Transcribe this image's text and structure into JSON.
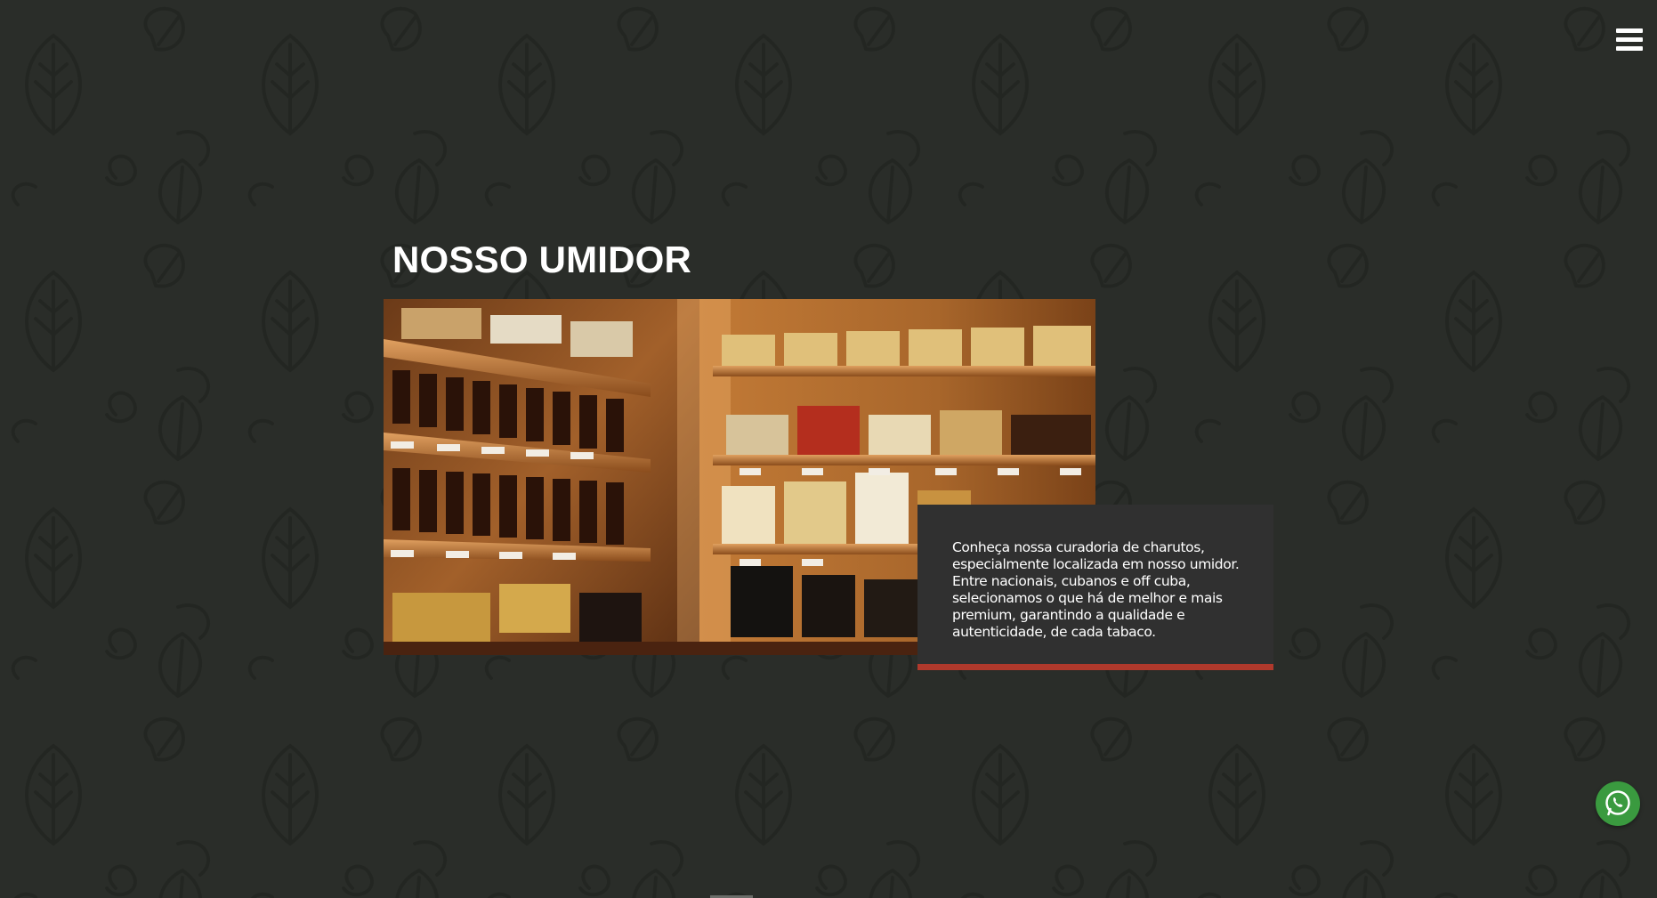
{
  "header": {
    "menu_icon": "hamburger-menu-icon"
  },
  "section": {
    "title": "NOSSO UMIDOR",
    "image_description_icon": "humidor-photo",
    "body": "Conheça nossa curadoria de charutos, especialmente localizada em nosso umidor. Entre nacionais, cubanos e off cuba, selecionamos o que há de melhor e mais premium, garantindo a qualidade e autenticidade, de cada tabaco."
  },
  "floating": {
    "whatsapp_icon": "whatsapp-icon"
  },
  "colors": {
    "background": "#2a2d29",
    "card": "#303030",
    "accent": "#b0392c",
    "whatsapp": "#3a9a3f"
  }
}
